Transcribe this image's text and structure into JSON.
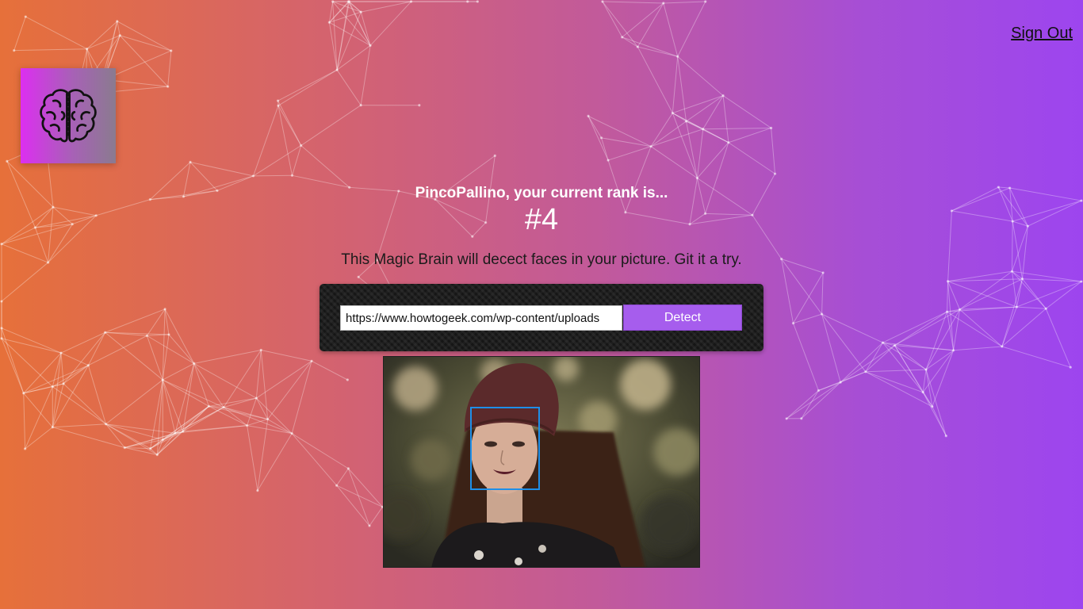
{
  "header": {
    "signout_label": "Sign Out"
  },
  "logo": {
    "icon": "brain-icon"
  },
  "rank": {
    "message": "PincoPallino, your current rank is...",
    "value": "#4"
  },
  "description": "This Magic Brain will decect faces in your picture. Git it a try.",
  "form": {
    "url_value": "https://www.howtogeek.com/wp-content/uploads",
    "detect_label": "Detect"
  },
  "image": {
    "face_box_color": "#1e8fe8"
  },
  "colors": {
    "gradient_start": "#e6703a",
    "gradient_end": "#9d45ef",
    "button": "#a65ded"
  }
}
